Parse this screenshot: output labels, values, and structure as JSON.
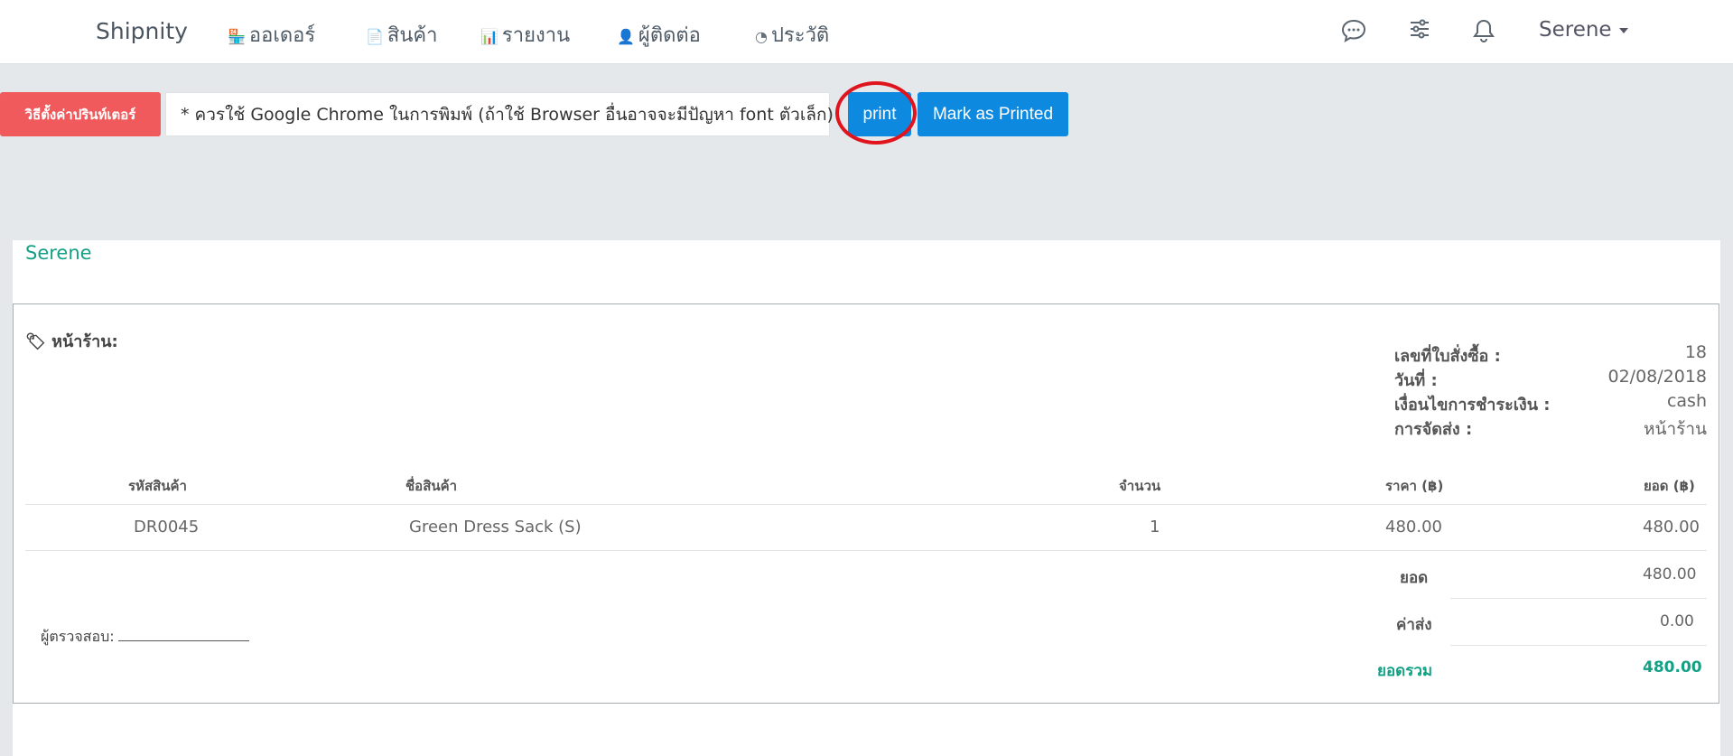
{
  "nav": {
    "brand": "Shipnity",
    "items": [
      {
        "label": "ออเดอร์",
        "icon": "store-icon"
      },
      {
        "label": "สินค้า",
        "icon": "product-icon"
      },
      {
        "label": "รายงาน",
        "icon": "report-icon"
      },
      {
        "label": "ผู้ติดต่อ",
        "icon": "contact-icon"
      },
      {
        "label": "ประวัติ",
        "icon": "history-icon"
      }
    ],
    "user": "Serene"
  },
  "toolbar": {
    "printer_setup": "วิธีตั้งค่าปรินท์เตอร์",
    "notice": "* ควรใช้ Google Chrome ในการพิมพ์ (ถ้าใช้ Browser อื่นอาจจะมีปัญหา font ตัวเล็ก)",
    "print": "print",
    "mark_printed": "Mark as Printed"
  },
  "invoice": {
    "shop_name": "Serene",
    "channel_label": "หน้าร้าน:",
    "meta": [
      {
        "label": "เลขที่ใบสั่งซื้อ :",
        "value": "18"
      },
      {
        "label": "วันที่ :",
        "value": "02/08/2018"
      },
      {
        "label": "เงื่อนไขการชำระเงิน :",
        "value": "cash"
      },
      {
        "label": "การจัดส่ง :",
        "value": "หน้าร้าน"
      }
    ],
    "columns": [
      "รหัสสินค้า",
      "ชื่อสินค้า",
      "จำนวน",
      "ราคา (฿)",
      "ยอด (฿)"
    ],
    "rows": [
      {
        "sku": "DR0045",
        "name": "Green Dress Sack (S)",
        "qty": "1",
        "price": "480.00",
        "amount": "480.00"
      }
    ],
    "summary": {
      "subtotal_label": "ยอด",
      "subtotal": "480.00",
      "shipping_label": "ค่าส่ง",
      "shipping": "0.00",
      "total_label": "ยอดรวม",
      "total": "480.00"
    },
    "checker_label": "ผู้ตรวจสอบ:"
  },
  "colors": {
    "accent_green": "#14a085",
    "danger": "#f05a5c",
    "primary": "#0d8ae0",
    "highlight": "#e0141d"
  }
}
